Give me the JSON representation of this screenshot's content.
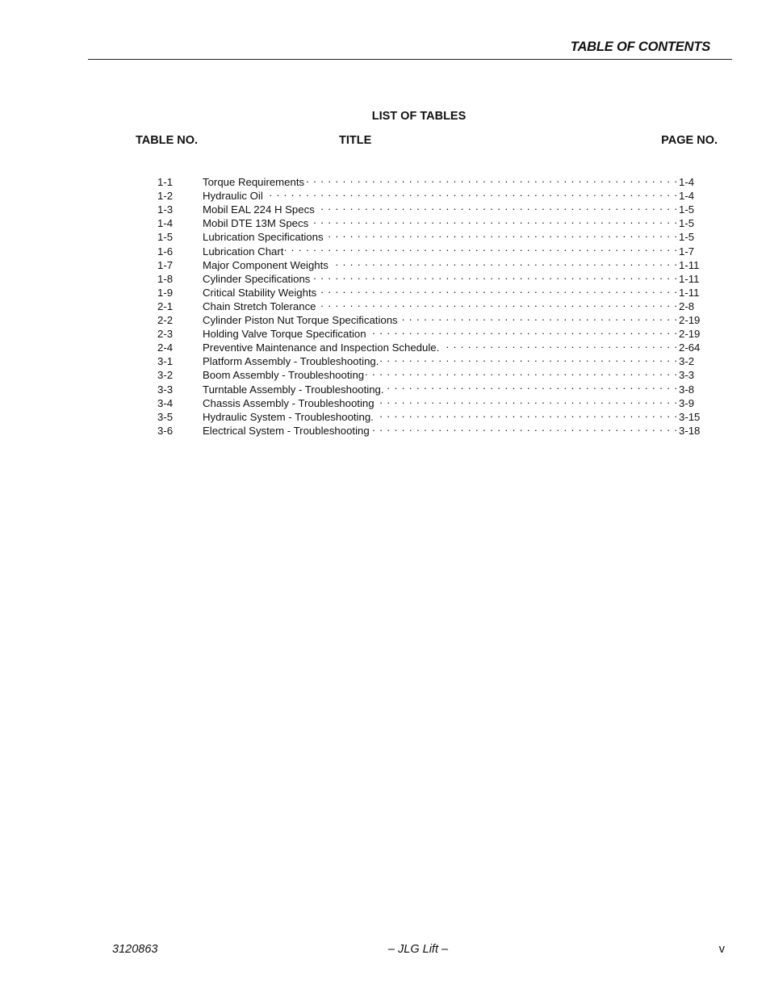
{
  "header": {
    "section_title": "TABLE OF CONTENTS"
  },
  "list": {
    "title": "LIST OF TABLES",
    "columns": {
      "table_no": "TABLE NO.",
      "title": "TITLE",
      "page_no": "PAGE NO."
    },
    "entries": [
      {
        "no": "1-1",
        "title": "Torque Requirements",
        "page": "1-4"
      },
      {
        "no": "1-2",
        "title": "Hydraulic Oil",
        "page": "1-4"
      },
      {
        "no": "1-3",
        "title": "Mobil EAL 224 H  Specs",
        "page": "1-5"
      },
      {
        "no": "1-4",
        "title": "Mobil DTE 13M  Specs",
        "page": "1-5"
      },
      {
        "no": "1-5",
        "title": "Lubrication Specifications",
        "page": "1-5"
      },
      {
        "no": "1-6",
        "title": "Lubrication Chart",
        "page": "1-7"
      },
      {
        "no": "1-7",
        "title": "Major Component Weights",
        "page": "1-11"
      },
      {
        "no": "1-8",
        "title": "Cylinder Specifications",
        "page": "1-11"
      },
      {
        "no": "1-9",
        "title": "Critical Stability Weights",
        "page": "1-11"
      },
      {
        "no": "2-1",
        "title": "Chain Stretch Tolerance",
        "page": "2-8"
      },
      {
        "no": "2-2",
        "title": "Cylinder Piston Nut Torque Specifications",
        "page": "2-19"
      },
      {
        "no": "2-3",
        "title": "Holding Valve Torque Specification",
        "page": "2-19"
      },
      {
        "no": "2-4",
        "title": "Preventive Maintenance and Inspection Schedule.",
        "page": "2-64"
      },
      {
        "no": "3-1",
        "title": "Platform Assembly - Troubleshooting.",
        "page": "3-2"
      },
      {
        "no": "3-2",
        "title": "Boom Assembly - Troubleshooting",
        "page": "3-3"
      },
      {
        "no": "3-3",
        "title": "Turntable Assembly - Troubleshooting.",
        "page": "3-8"
      },
      {
        "no": "3-4",
        "title": "Chassis Assembly - Troubleshooting",
        "page": "3-9"
      },
      {
        "no": "3-5",
        "title": "Hydraulic System - Troubleshooting.",
        "page": "3-15"
      },
      {
        "no": "3-6",
        "title": "Electrical System - Troubleshooting",
        "page": "3-18"
      }
    ]
  },
  "footer": {
    "doc_number": "3120863",
    "brand": "– JLG Lift –",
    "page": "v"
  }
}
